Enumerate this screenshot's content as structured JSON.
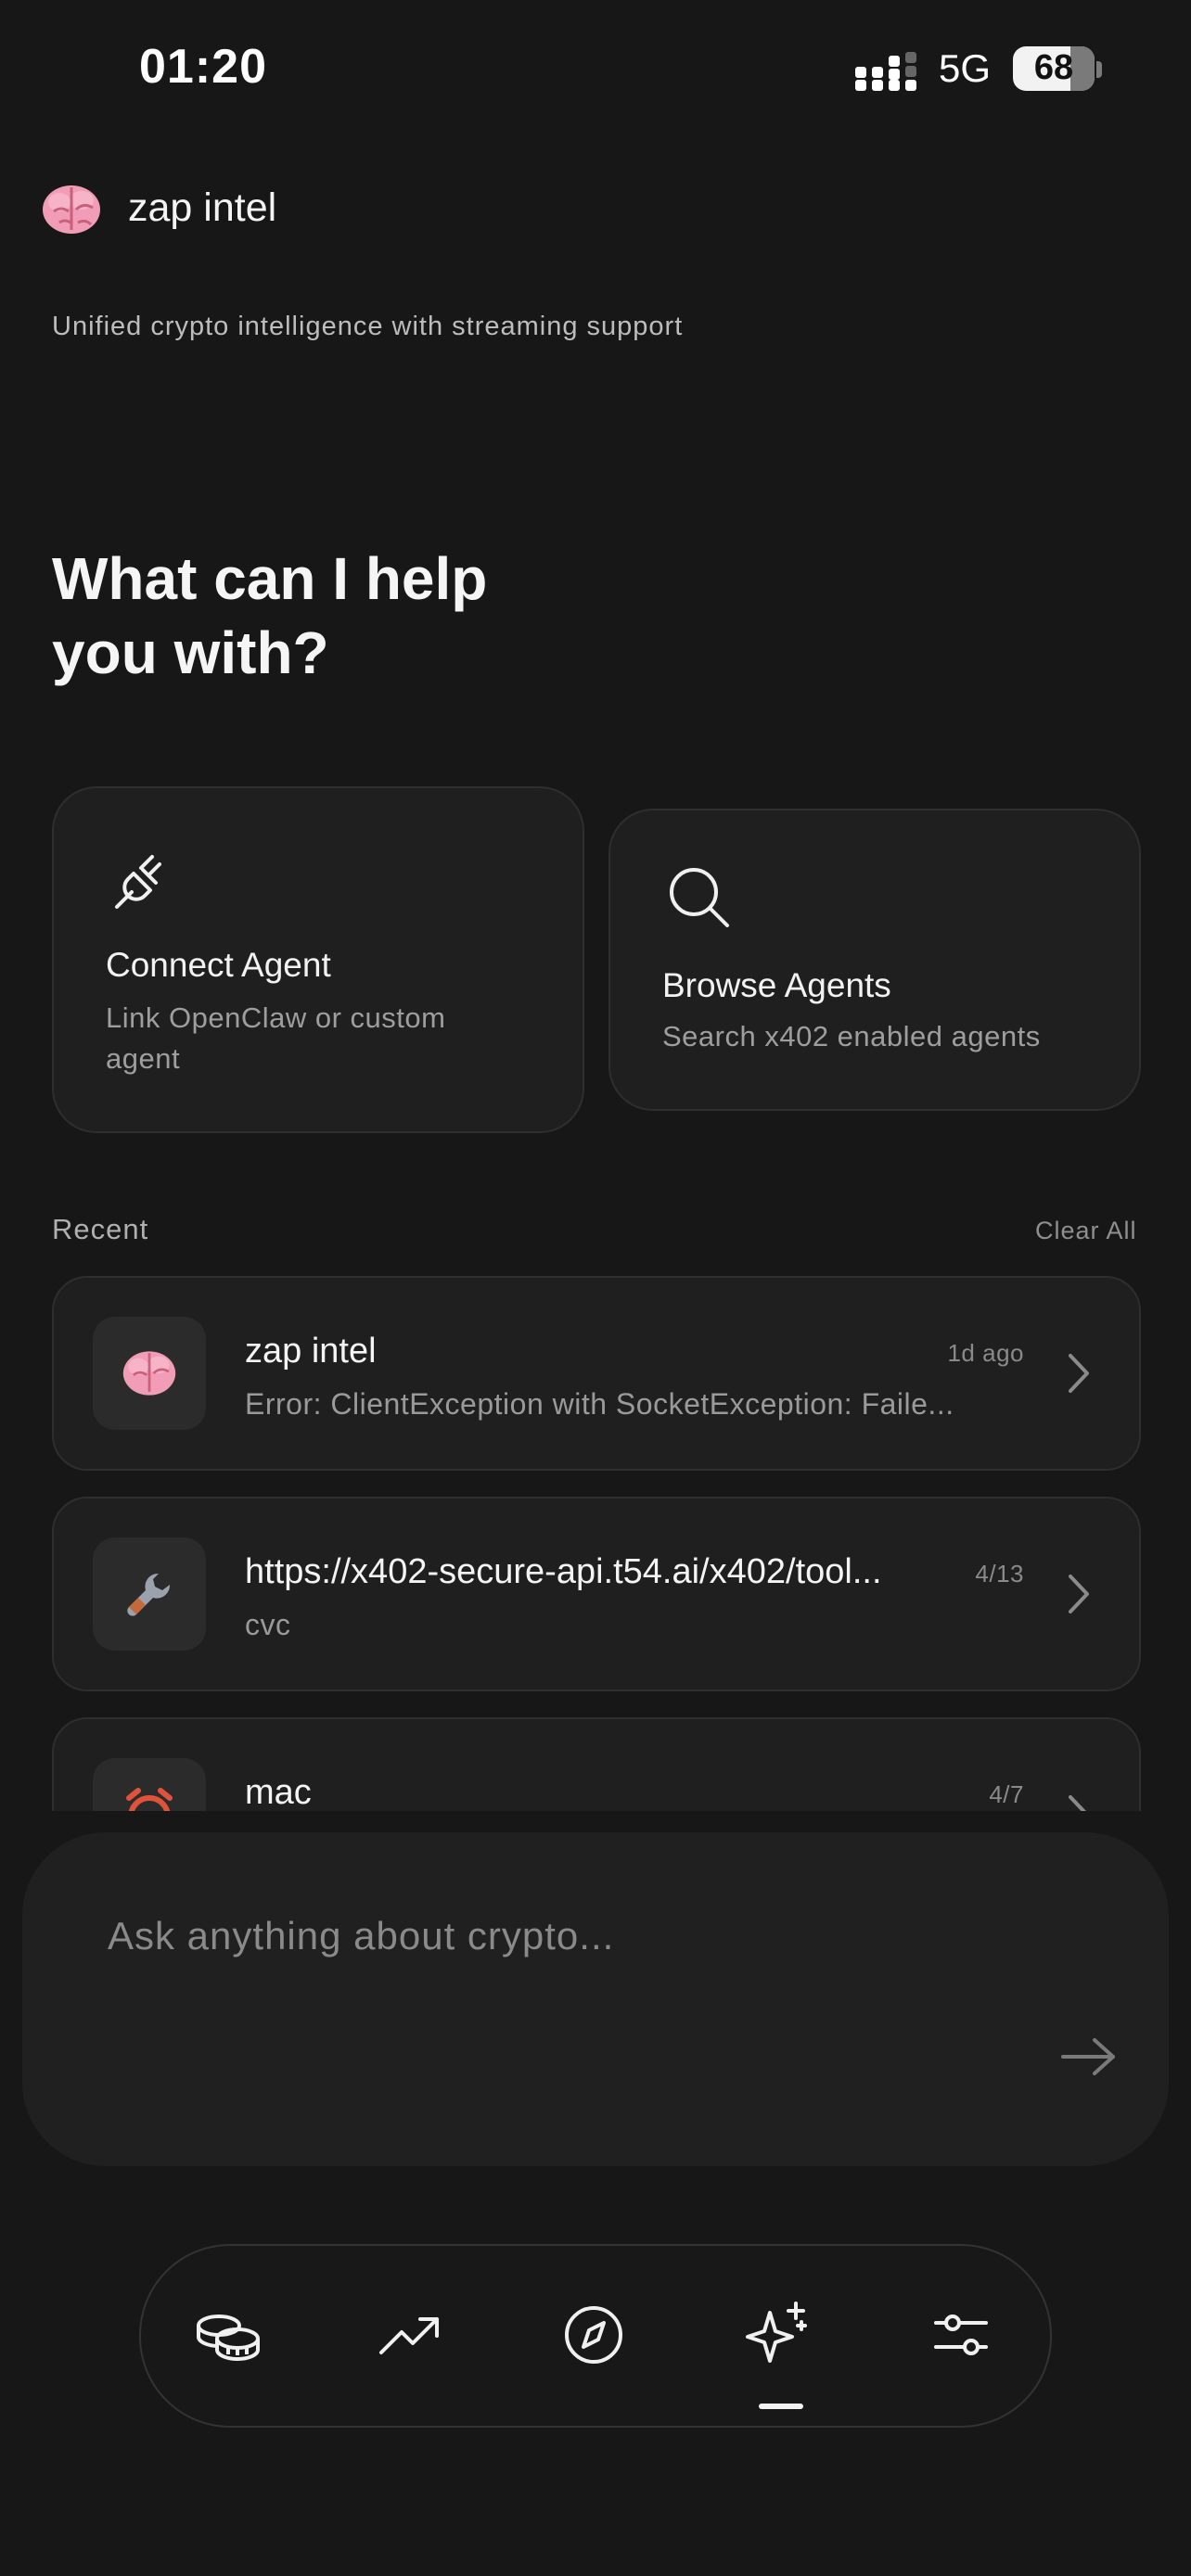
{
  "status_bar": {
    "time": "01:20",
    "network": "5G",
    "battery": "68"
  },
  "header": {
    "app_name": "zap intel",
    "emoji": "🧠",
    "tagline": "Unified crypto intelligence with streaming support"
  },
  "hero": {
    "line1": "What can I help",
    "line2": "you with?"
  },
  "actions": [
    {
      "title": "Connect Agent",
      "subtitle_line1": "Link OpenClaw or custom",
      "subtitle_line2": "agent",
      "icon": "plug-icon"
    },
    {
      "title": "Browse Agents",
      "subtitle": "Search x402 enabled agents",
      "icon": "search-icon"
    }
  ],
  "recent": {
    "label": "Recent",
    "clear_label": "Clear All",
    "items": [
      {
        "title": "zap intel",
        "subtitle": "Error: ClientException with SocketException: Faile...",
        "time": "1d ago",
        "icon": "brain-icon"
      },
      {
        "title": "https://x402-secure-api.t54.ai/x402/tool...",
        "subtitle": "cvc",
        "time": "4/13",
        "icon": "wrench-icon"
      },
      {
        "title": "mac",
        "subtitle": "",
        "time": "4/7",
        "icon": "alarm-icon"
      }
    ]
  },
  "composer": {
    "placeholder": "Ask anything about crypto..."
  },
  "nav": {
    "items": [
      "coins-icon",
      "trending-icon",
      "compass-icon",
      "sparkles-icon",
      "sliders-icon"
    ],
    "active": "sparkles-icon"
  },
  "colors": {
    "background": "#171717",
    "card": "#1f1f1f",
    "border": "#2e2e2e",
    "text": "#f2f2f2",
    "muted": "#9a9a9a"
  }
}
